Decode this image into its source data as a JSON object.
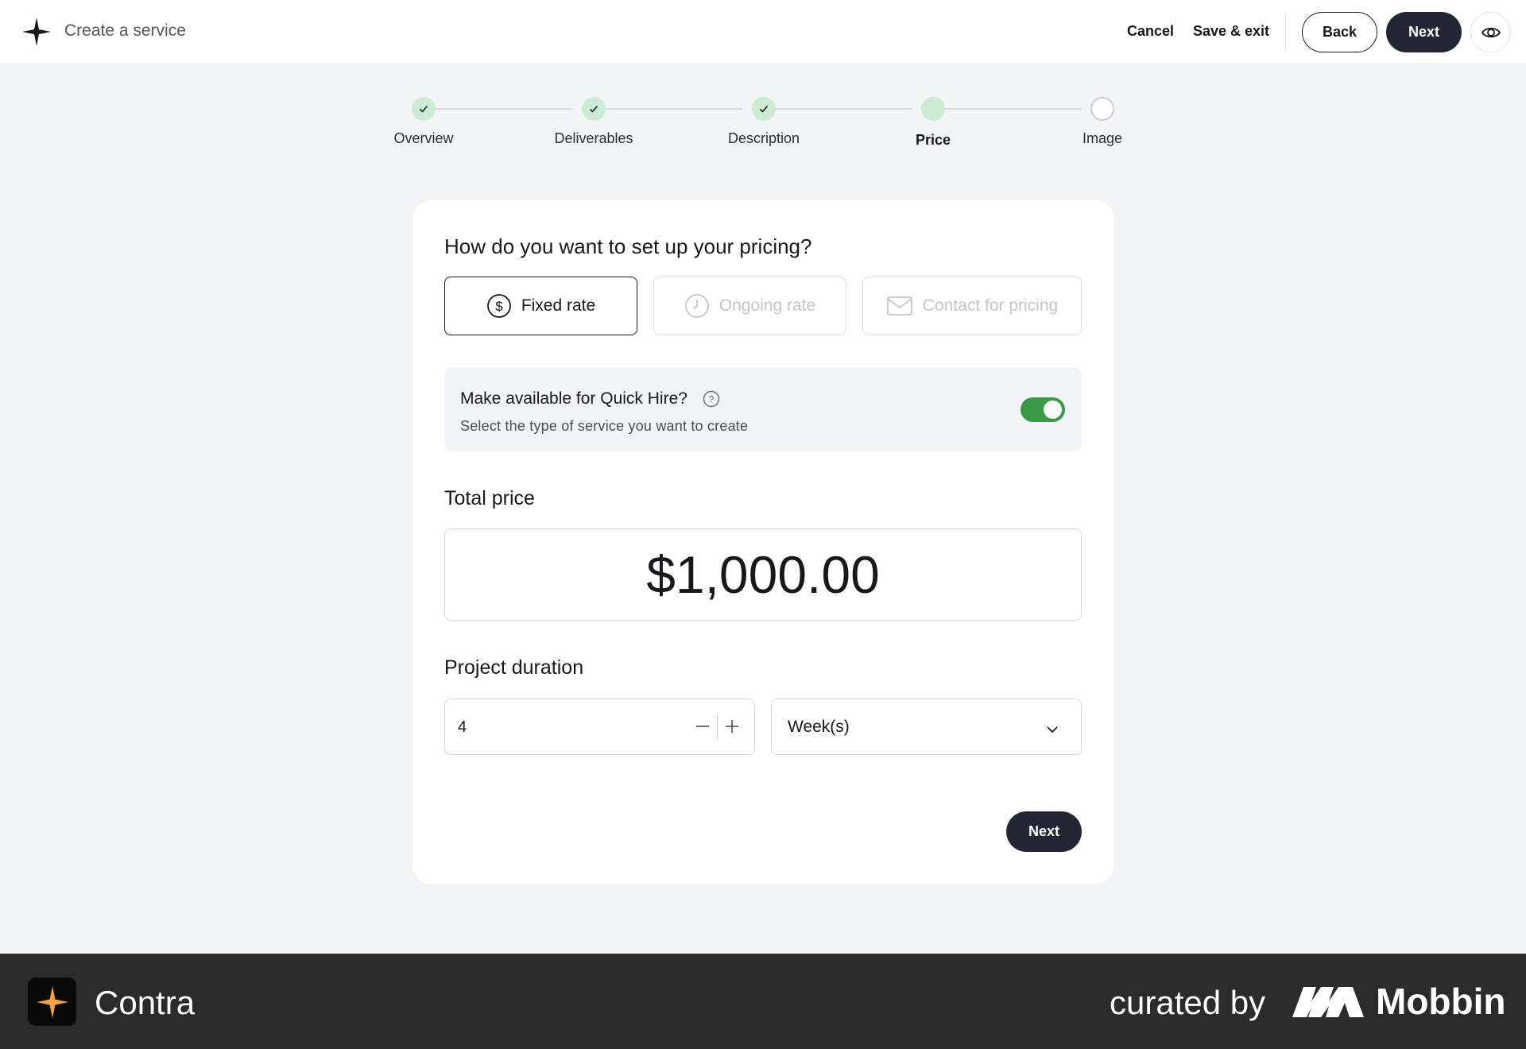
{
  "header": {
    "title": "Create a service",
    "cancel_label": "Cancel",
    "save_exit_label": "Save & exit",
    "back_label": "Back",
    "next_label": "Next",
    "preview_icon": "eye-icon"
  },
  "stepper": {
    "steps": [
      {
        "label": "Overview",
        "state": "done"
      },
      {
        "label": "Deliverables",
        "state": "done"
      },
      {
        "label": "Description",
        "state": "done"
      },
      {
        "label": "Price",
        "state": "current"
      },
      {
        "label": "Image",
        "state": "todo"
      }
    ]
  },
  "pricing": {
    "question": "How do you want to set up your pricing?",
    "options": [
      {
        "label": "Fixed rate",
        "icon": "dollar-circle-icon",
        "selected": true
      },
      {
        "label": "Ongoing rate",
        "icon": "clock-icon",
        "disabled": true
      },
      {
        "label": "Contact for pricing",
        "icon": "mail-icon",
        "disabled": true
      }
    ],
    "quick_hire": {
      "title": "Make available for Quick Hire?",
      "subtitle": "Select the type of service you want to create",
      "enabled": true
    },
    "total_price_label": "Total price",
    "total_price_value": "$1,000.00",
    "duration_label": "Project duration",
    "duration_value": "4",
    "duration_unit": "Week(s)",
    "next_label": "Next"
  },
  "footer": {
    "brand": "Contra",
    "curated_by": "curated by",
    "curator": "Mobbin"
  },
  "colors": {
    "primary_dark": "#222833",
    "toggle_on": "#3a9a4a",
    "step_done": "#cdebd3",
    "footer_bg": "#2b2b2b",
    "contra_accent": "#f5a043"
  }
}
